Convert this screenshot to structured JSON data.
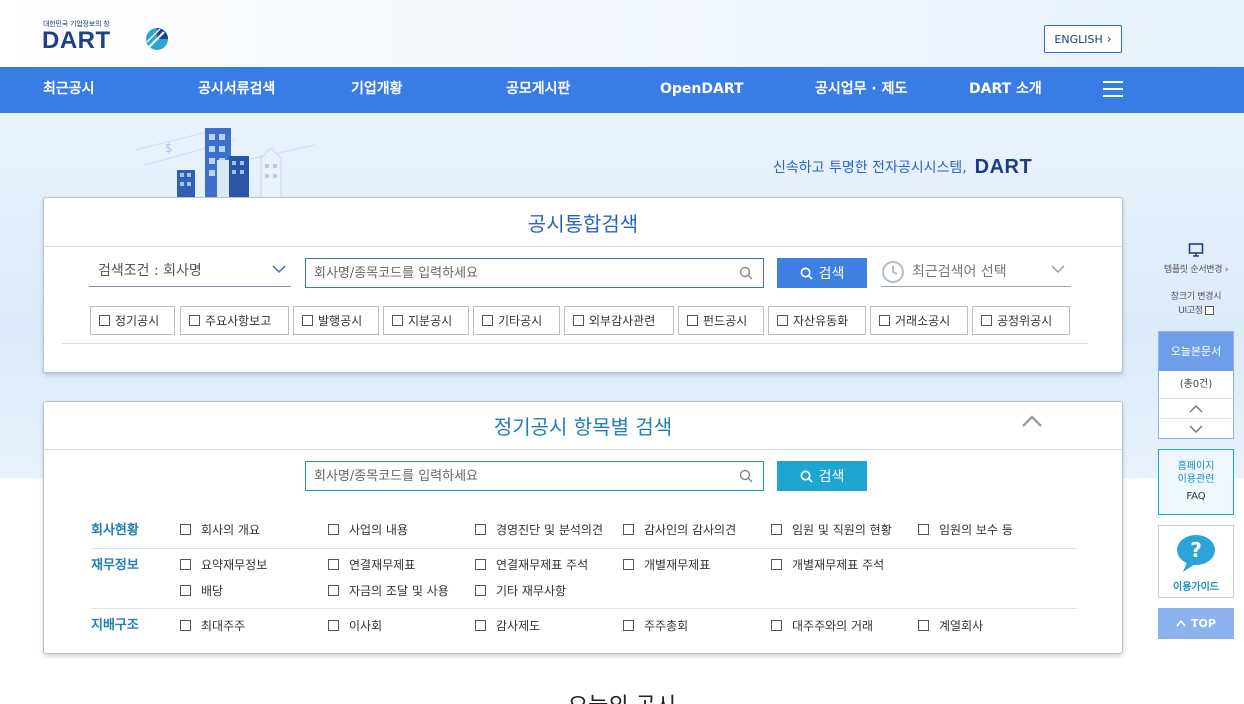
{
  "header": {
    "logo_tagline": "대한민국 기업정보의 창",
    "logo_text": "DART",
    "english_button": "ENGLISH"
  },
  "gnb": {
    "items": [
      "최근공시",
      "공시서류검색",
      "기업개황",
      "공모게시판",
      "OpenDART",
      "공시업무 · 제도",
      "DART 소개"
    ]
  },
  "hero": {
    "tagline": "신속하고 투명한 전자공시시스템,",
    "tagline_brand": "DART"
  },
  "unified_search": {
    "title": "공시통합검색",
    "condition_select": "검색조건 : 회사명",
    "search_placeholder": "회사명/종목코드를 입력하세요",
    "search_button": "검색",
    "recent_select": "최근검색어 선택",
    "filters": [
      "정기공시",
      "주요사항보고",
      "발행공시",
      "지분공시",
      "기타공시",
      "외부감사관련",
      "펀드공시",
      "자산유동화",
      "거래소공시",
      "공정위공시"
    ]
  },
  "periodic_search": {
    "title": "정기공시 항목별 검색",
    "search_placeholder": "회사명/종목코드를 입력하세요",
    "search_button": "검색",
    "categories": [
      {
        "label": "회사현황",
        "options": [
          "회사의 개요",
          "사업의 내용",
          "경영진단 및 분석의견",
          "감사인의 감사의견",
          "임원 및 직원의 현황",
          "임원의 보수 등"
        ]
      },
      {
        "label": "재무정보",
        "options": [
          "요약재무정보",
          "연결재무제표",
          "연결재무제표 주석",
          "개별재무제표",
          "개별재무제표 주석",
          "배당",
          "자금의 조달 및 사용",
          "기타 재무사항"
        ]
      },
      {
        "label": "지배구조",
        "options": [
          "최대주주",
          "이사회",
          "감사제도",
          "주주총회",
          "대주주와의 거래",
          "계열회사"
        ]
      }
    ]
  },
  "quick_bar": {
    "template_order": "템플릿 순서변경",
    "ui_fix_line1": "창크기 변경시",
    "ui_fix_line2": "UI고정",
    "today_docs": "오늘본문서",
    "today_count": "(총0건)",
    "faq_line1": "홈페이지",
    "faq_line2": "이용관련",
    "faq_line3": "FAQ",
    "guide": "이용가이드",
    "top": "TOP"
  },
  "bottom": {
    "heading": "오늘의 공시"
  },
  "colors": {
    "gnb": "#3a7ce6",
    "title_blue": "#2a63c7",
    "teal": "#1ea5d0"
  }
}
